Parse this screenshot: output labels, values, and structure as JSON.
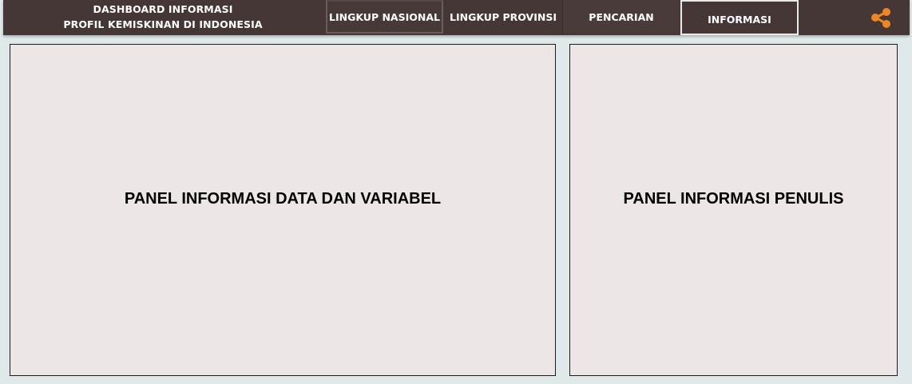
{
  "header": {
    "title_line1": "DASHBOARD INFORMASI",
    "title_line2": "PROFIL KEMISKINAN DI INDONESIA",
    "tabs": [
      {
        "label": "LINGKUP NASIONAL"
      },
      {
        "label": "LINGKUP PROVINSI"
      },
      {
        "label": "PENCARIAN"
      },
      {
        "label": "INFORMASI",
        "active": true
      }
    ],
    "share_icon": "share-icon"
  },
  "main": {
    "left_panel_label": "PANEL INFORMASI DATA DAN VARIABEL",
    "right_panel_label": "PANEL INFORMASI PENULIS"
  },
  "colors": {
    "topbar": "#463737",
    "page_background": "#dfe9ea",
    "panel_background": "#ece6e6",
    "share_icon": "#f2861e"
  }
}
